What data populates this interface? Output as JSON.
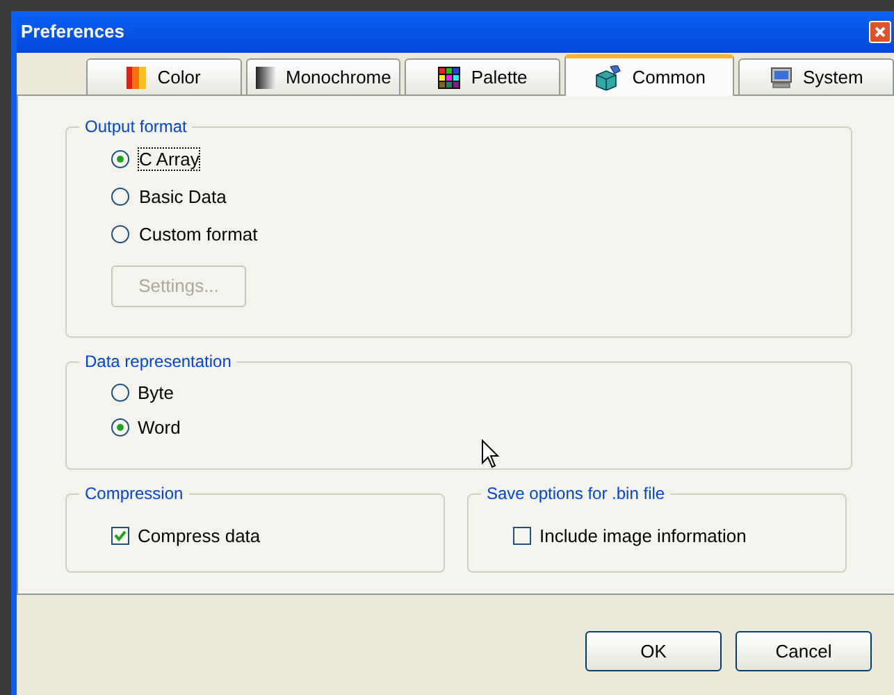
{
  "window": {
    "title": "Preferences"
  },
  "tabs": [
    {
      "label": "Color",
      "selected": false
    },
    {
      "label": "Monochrome",
      "selected": false
    },
    {
      "label": "Palette",
      "selected": false
    },
    {
      "label": "Common",
      "selected": true
    },
    {
      "label": "System",
      "selected": false
    }
  ],
  "output_format": {
    "title": "Output format",
    "options": [
      {
        "label": "C Array",
        "selected": true,
        "focused": true
      },
      {
        "label": "Basic Data",
        "selected": false,
        "focused": false
      },
      {
        "label": "Custom format",
        "selected": false,
        "focused": false
      }
    ],
    "settings_button": {
      "label": "Settings...",
      "disabled": true
    }
  },
  "data_representation": {
    "title": "Data representation",
    "options": [
      {
        "label": "Byte",
        "selected": false
      },
      {
        "label": "Word",
        "selected": true
      }
    ]
  },
  "compression": {
    "title": "Compression",
    "checkbox": {
      "label": "Compress data",
      "checked": true
    }
  },
  "save_options": {
    "title": "Save options for .bin file",
    "checkbox": {
      "label": "Include image information",
      "checked": false
    }
  },
  "buttons": [
    "OK",
    "Cancel"
  ]
}
